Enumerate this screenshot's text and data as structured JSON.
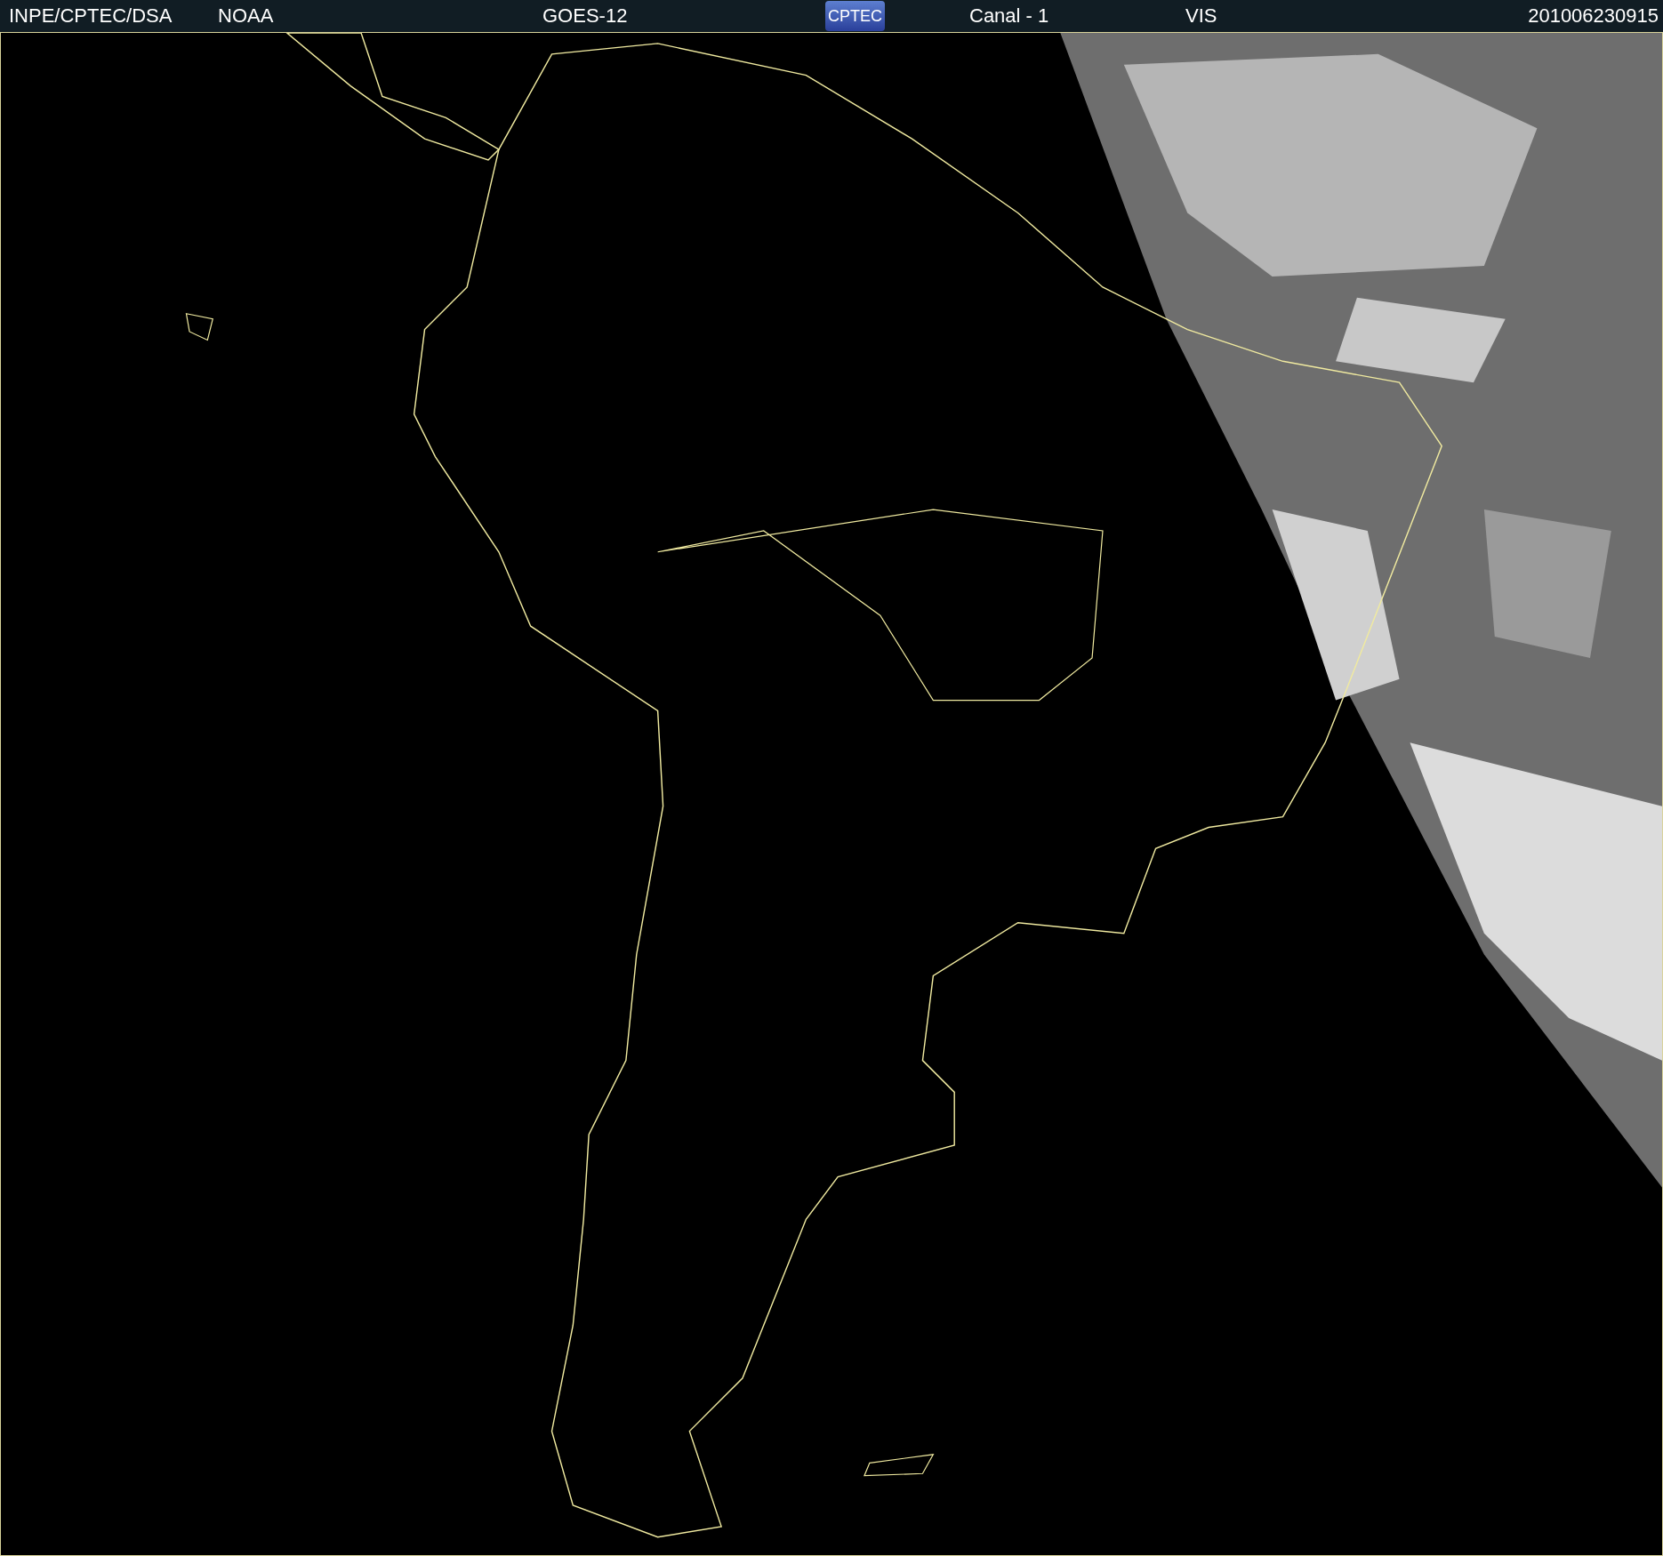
{
  "header": {
    "items": [
      {
        "kind": "text",
        "text": "INPE/CPTEC/DSA"
      },
      {
        "kind": "text",
        "text": "NOAA"
      },
      {
        "kind": "text",
        "text": "GOES-12"
      },
      {
        "kind": "logo",
        "text": "CPTEC"
      },
      {
        "kind": "text",
        "text": "Canal - 1"
      },
      {
        "kind": "text",
        "text": "VIS"
      },
      {
        "kind": "text",
        "text": "201006230915"
      }
    ]
  }
}
